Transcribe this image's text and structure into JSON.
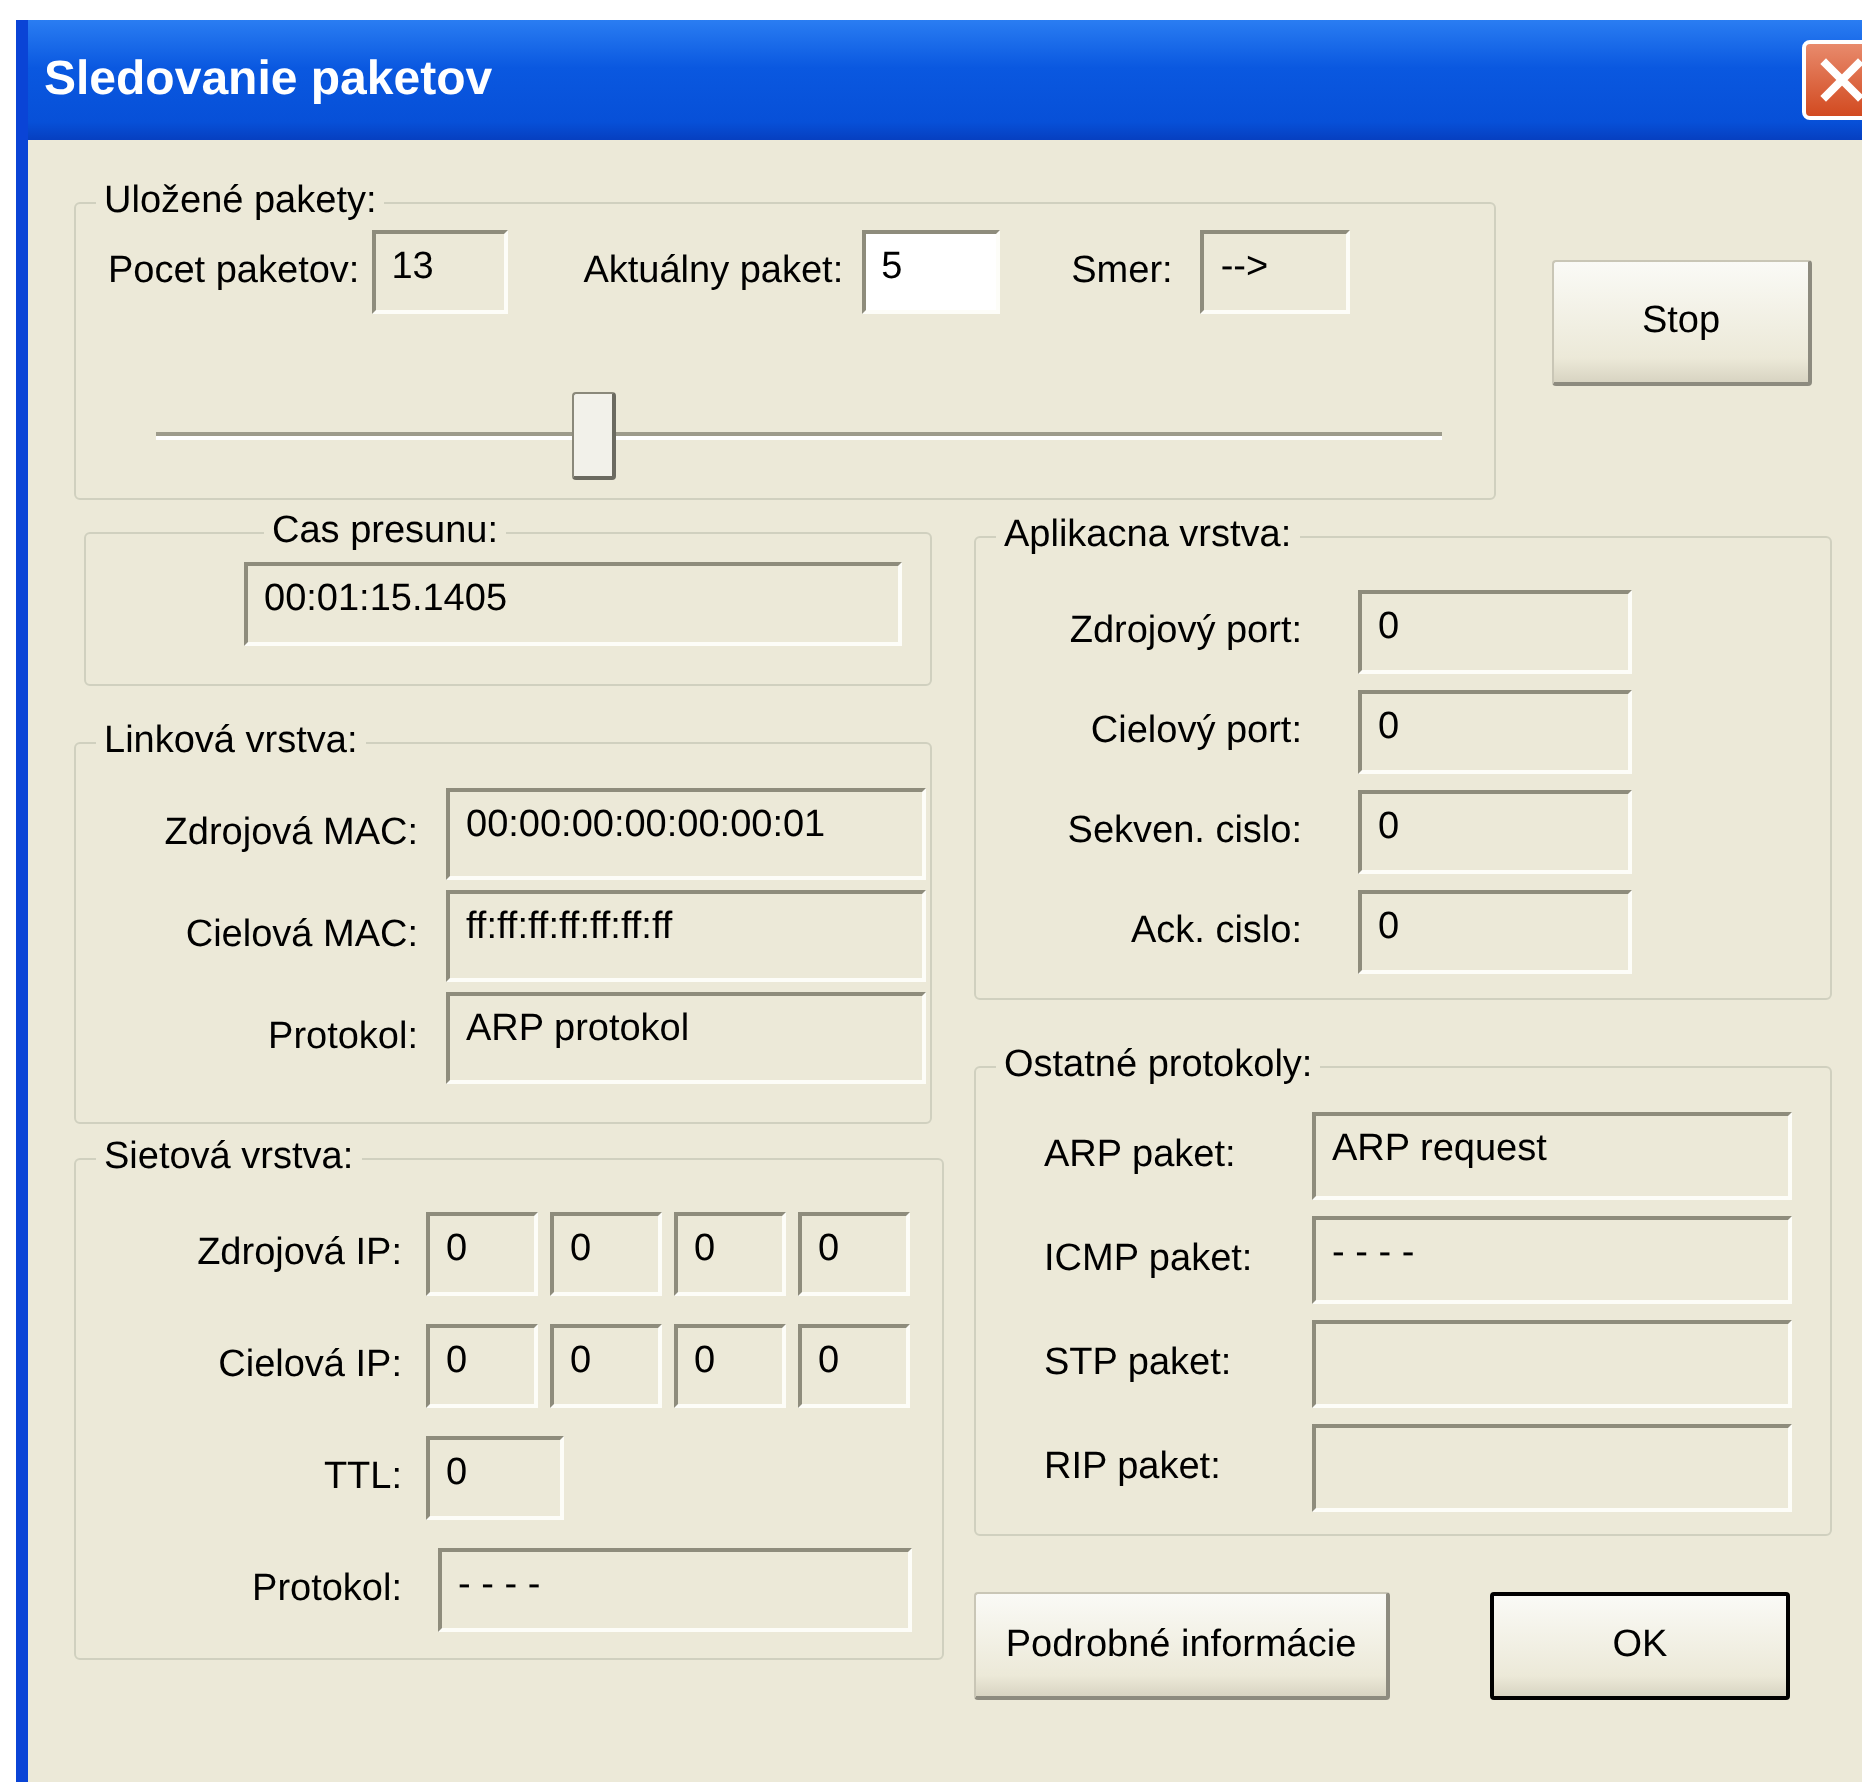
{
  "window": {
    "title": "Sledovanie paketov"
  },
  "stored": {
    "legend": "Uložené pakety:",
    "fields": [
      {
        "label": "Pocet paketov:",
        "value": "13",
        "editable": false
      },
      {
        "label": "Aktuálny paket:",
        "value": "5",
        "editable": true
      },
      {
        "label": "Smer:",
        "value": "-->",
        "editable": false
      }
    ],
    "slider": {
      "level": 0.34
    }
  },
  "stop_button": "Stop",
  "transfer_time": {
    "legend": "Cas presunu:",
    "value": "00:01:15.1405"
  },
  "link_layer": {
    "legend": "Linková vrstva:",
    "fields": [
      {
        "label": "Zdrojová MAC:",
        "value": "00:00:00:00:00:00:01"
      },
      {
        "label": "Cielová MAC:",
        "value": "ff:ff:ff:ff:ff:ff:ff"
      },
      {
        "label": "Protokol:",
        "value": "ARP protokol"
      }
    ]
  },
  "network_layer": {
    "legend": "Sietová vrstva:",
    "fields": [
      {
        "kind": "ip",
        "label": "Zdrojová IP:",
        "values": [
          "0",
          "0",
          "0",
          "0"
        ]
      },
      {
        "kind": "ip",
        "label": "Cielová IP:",
        "values": [
          "0",
          "0",
          "0",
          "0"
        ]
      },
      {
        "kind": "short",
        "label": "TTL:",
        "value": "0"
      },
      {
        "kind": "wide",
        "label": "Protokol:",
        "value": "- - - -"
      }
    ]
  },
  "app_layer": {
    "legend": "Aplikacna vrstva:",
    "fields": [
      {
        "label": "Zdrojový port:",
        "value": "0"
      },
      {
        "label": "Cielový port:",
        "value": "0"
      },
      {
        "label": "Sekven. cislo:",
        "value": "0"
      },
      {
        "label": "Ack. cislo:",
        "value": "0"
      }
    ]
  },
  "other_protocols": {
    "legend": "Ostatné protokoly:",
    "fields": [
      {
        "label": "ARP paket:",
        "value": "ARP request"
      },
      {
        "label": "ICMP paket:",
        "value": "- - - -"
      },
      {
        "label": "STP paket:"
      },
      {
        "label": "RIP paket:"
      }
    ]
  },
  "buttons": [
    {
      "label": "Podrobné informácie",
      "default": false
    },
    {
      "label": "OK",
      "default": true
    }
  ]
}
